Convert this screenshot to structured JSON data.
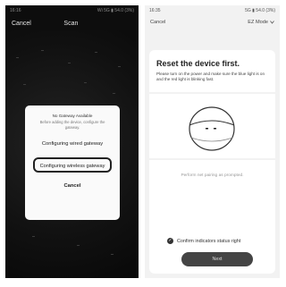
{
  "left": {
    "status": {
      "time": "16:16",
      "right": "Wi 5G ▮ 54.0 (3%)"
    },
    "header": {
      "cancel": "Cancel",
      "title": "Scan"
    },
    "dialog": {
      "title": "No Gateway Available",
      "subtitle": "Before adding the device, configure the gateway.",
      "option_wired": "Configuring wired gateway",
      "option_wireless": "Configuring wireless gateway",
      "cancel": "Cancel"
    }
  },
  "right": {
    "status": {
      "time": "16:35",
      "right": "5G ▮ 54.0 (3%)"
    },
    "header": {
      "cancel": "Cancel",
      "mode": "EZ Mode"
    },
    "title": "Reset the device first.",
    "description": "Please turn on the power and make sure the blue light is on and the red light is blinking fast.",
    "hint": "Perform net pairing as prompted.",
    "confirm_label": "Confirm indicators status right",
    "next_button": "Next"
  },
  "colors": {
    "dark_bg": "#0d0d0d",
    "light_bg": "#f2f2f2",
    "button": "#444444"
  },
  "icons": {
    "mode": "chevron-down-icon",
    "confirm": "check-circle-icon"
  }
}
